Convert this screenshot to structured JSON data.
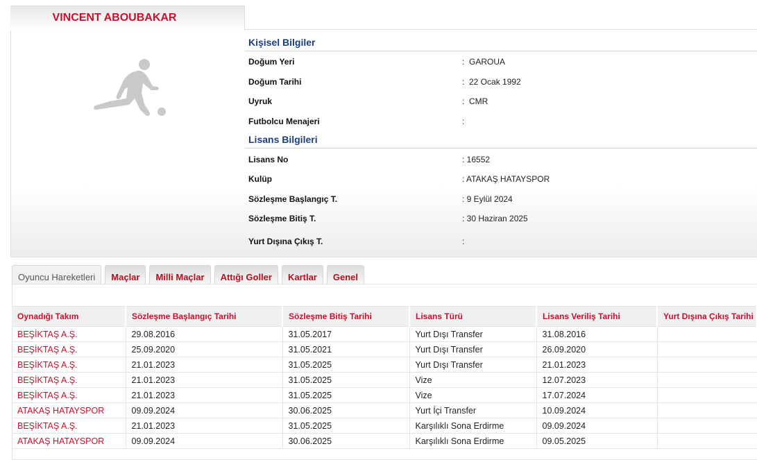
{
  "player": {
    "name": "VINCENT ABOUBAKAR"
  },
  "personal": {
    "title": "Kişisel Bilgiler",
    "rows": [
      {
        "label": "Doğum Yeri",
        "value": ":  GAROUA"
      },
      {
        "label": "Doğum Tarihi",
        "value": ":  22 Ocak 1992"
      },
      {
        "label": "Uyruk",
        "value": ":  CMR"
      },
      {
        "label": "Futbolcu Menajeri",
        "value": ":"
      }
    ]
  },
  "license": {
    "title": "Lisans Bilgileri",
    "rows": [
      {
        "label": "Lisans No",
        "value": ": 16552"
      },
      {
        "label": "Kulüp",
        "value": ": ATAKAŞ HATAYSPOR"
      },
      {
        "label": "Sözleşme Başlangıç T.",
        "value": ": 9 Eylül 2024"
      },
      {
        "label": "Sözleşme Bitiş T.",
        "value": ": 30 Haziran 2025"
      },
      {
        "label": "Yurt Dışına Çıkış T.",
        "value": ":"
      }
    ]
  },
  "tabs": [
    {
      "label": "Oyuncu Hareketleri",
      "active": true
    },
    {
      "label": "Maçlar"
    },
    {
      "label": "Milli Maçlar"
    },
    {
      "label": "Attığı Goller"
    },
    {
      "label": "Kartlar"
    },
    {
      "label": "Genel"
    }
  ],
  "movements": {
    "columns": [
      "Oynadığı Takım",
      "Sözleşme Başlangıç Tarihi",
      "Sözleşme Bitiş Tarihi",
      "Lisans Türü",
      "Lisans Veriliş Tarihi",
      "Yurt Dışına Çıkış Tarihi"
    ],
    "rows": [
      [
        "BEŞİKTAŞ A.Ş.",
        "29.08.2016",
        "31.05.2017",
        "Yurt Dışı Transfer",
        "31.08.2016",
        ""
      ],
      [
        "BEŞİKTAŞ A.Ş.",
        "25.09.2020",
        "31.05.2021",
        "Yurt Dışı Transfer",
        "26.09.2020",
        ""
      ],
      [
        "BEŞİKTAŞ A.Ş.",
        "21.01.2023",
        "31.05.2025",
        "Yurt Dışı Transfer",
        "21.01.2023",
        ""
      ],
      [
        "BEŞİKTAŞ A.Ş.",
        "21.01.2023",
        "31.05.2025",
        "Vize",
        "12.07.2023",
        ""
      ],
      [
        "BEŞİKTAŞ A.Ş.",
        "21.01.2023",
        "31.05.2025",
        "Vize",
        "17.07.2024",
        ""
      ],
      [
        "ATAKAŞ HATAYSPOR",
        "09.09.2024",
        "30.06.2025",
        "Yurt İçi Transfer",
        "10.09.2024",
        ""
      ],
      [
        "BEŞİKTAŞ A.Ş.",
        "21.01.2023",
        "31.05.2025",
        "Karşılıklı Sona Erdirme",
        "09.09.2024",
        ""
      ],
      [
        "ATAKAŞ HATAYSPOR",
        "09.09.2024",
        "30.06.2025",
        "Karşılıklı Sona Erdirme",
        "09.05.2025",
        ""
      ]
    ]
  },
  "colors": {
    "accent": "#c8102e",
    "section": "#1a3d7c"
  },
  "icons": {
    "player_photo": "footballer-silhouette-icon"
  }
}
